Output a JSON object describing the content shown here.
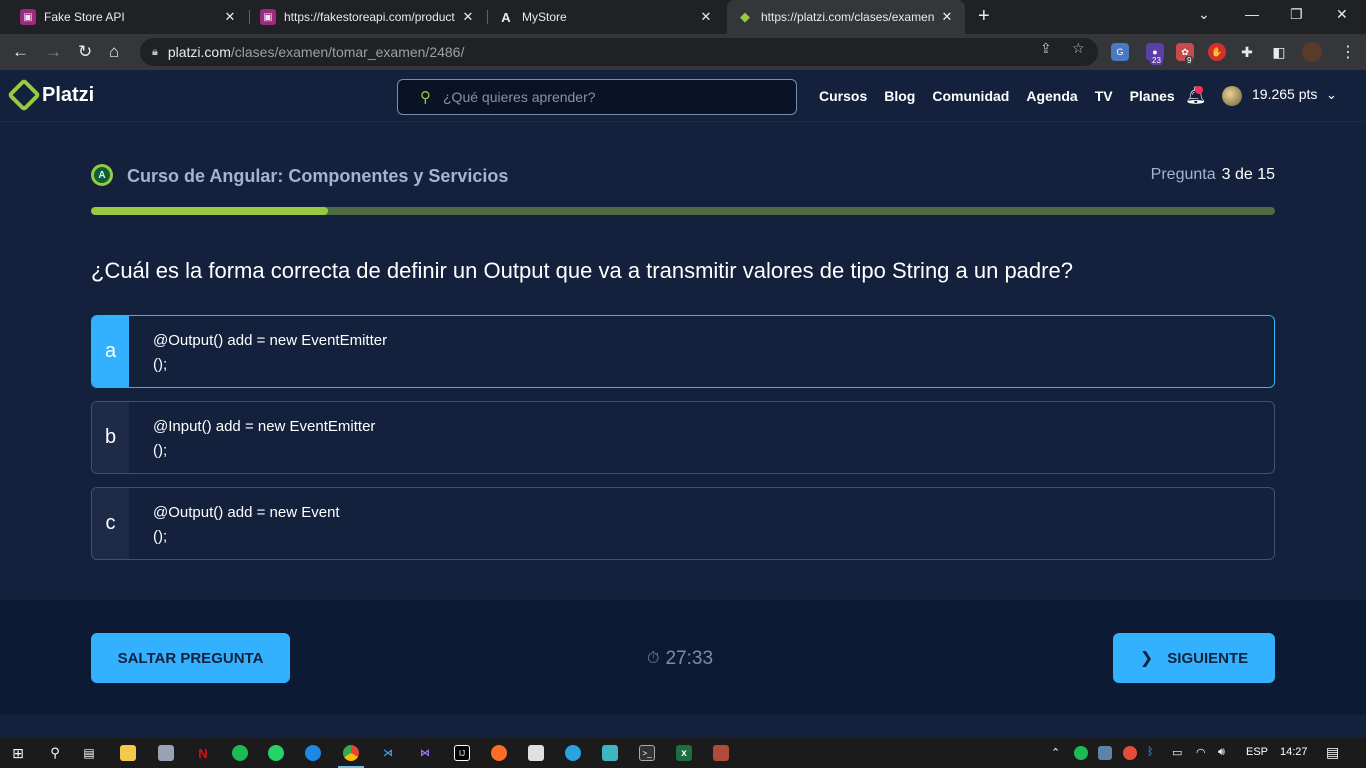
{
  "browser": {
    "tabs": [
      {
        "title": "Fake Store API",
        "favicon": "fakestore-icon",
        "active": false
      },
      {
        "title": "https://fakestoreapi.com/product",
        "favicon": "fakestore-icon",
        "active": false
      },
      {
        "title": "MyStore",
        "favicon": "angular-icon",
        "active": false
      },
      {
        "title": "https://platzi.com/clases/examen",
        "favicon": "platzi-icon",
        "active": true
      }
    ],
    "url_host": "platzi.com",
    "url_path": "/clases/examen/tomar_examen/2486/",
    "extension_badges": [
      "23",
      "9"
    ]
  },
  "header": {
    "logo": "Platzi",
    "search_placeholder": "¿Qué quieres aprender?",
    "nav": [
      "Cursos",
      "Blog",
      "Comunidad",
      "Agenda",
      "TV",
      "Planes"
    ],
    "points": "19.265 pts"
  },
  "exam": {
    "course_icon_letter": "A",
    "course_title": "Curso de Angular: Componentes y Servicios",
    "question_label": "Pregunta",
    "question_counter": "3 de 15",
    "progress_fraction": 0.2,
    "question": "¿Cuál es la forma correcta de definir un Output que va a transmitir valores de tipo String a un padre?",
    "options": [
      {
        "letter": "a",
        "text": "@Output() add = new EventEmitter\n();",
        "selected": true
      },
      {
        "letter": "b",
        "text": "@Input() add = new EventEmitter\n();",
        "selected": false
      },
      {
        "letter": "c",
        "text": "@Output() add = new Event\n();",
        "selected": false
      }
    ]
  },
  "footer": {
    "skip_label": "SALTAR PREGUNTA",
    "timer": "27:33",
    "next_label": "SIGUIENTE"
  },
  "taskbar": {
    "tray_lang": "ESP",
    "time": "14:27"
  },
  "colors": {
    "accent_blue": "#33b1ff",
    "platzi_green": "#98ca3f",
    "background": "#13213c"
  }
}
